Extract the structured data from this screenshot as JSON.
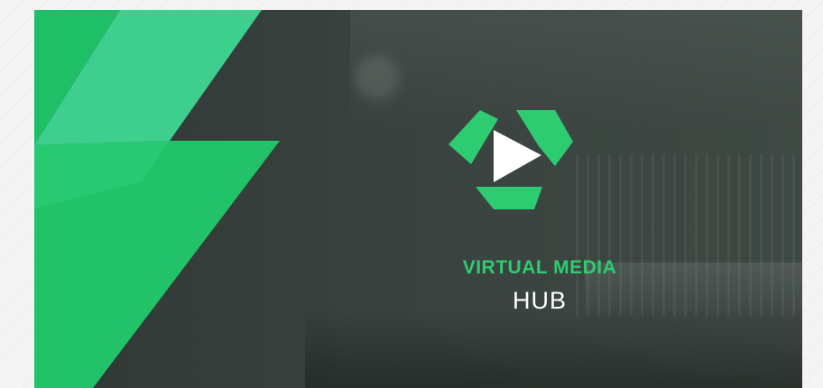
{
  "brand": {
    "line1": "VIRTUAL MEDIA",
    "line2": "HUB"
  },
  "colors": {
    "accent": "#2ecc71",
    "accent_light": "#3ecf8e",
    "text": "#ffffff",
    "background": "#39423e"
  },
  "icons": {
    "logo": "play-triangle-logo-icon"
  }
}
